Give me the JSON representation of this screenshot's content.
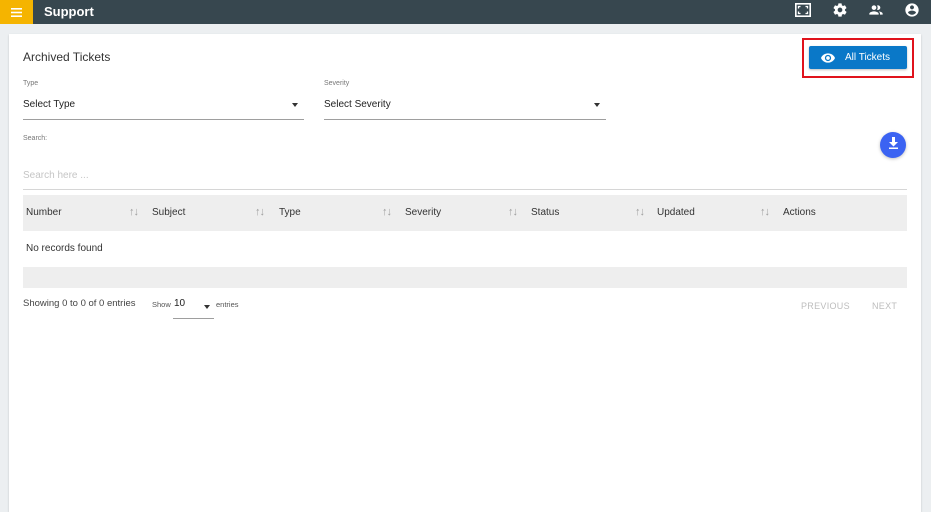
{
  "topbar": {
    "title": "Support",
    "icons": [
      "menu-icon",
      "fullscreen-icon",
      "settings-icon",
      "users-icon",
      "account-icon"
    ],
    "accent_color": "#f5b400",
    "background_color": "#37474f"
  },
  "page": {
    "title": "Archived Tickets",
    "all_tickets_label": "All Tickets",
    "all_tickets_color": "#0a78c8",
    "highlight_color": "#e0131c"
  },
  "filters": {
    "type_label": "Type",
    "type_value": "Select Type",
    "severity_label": "Severity",
    "severity_value": "Select Severity",
    "search_label": "Search:",
    "search_placeholder": "Search here ..."
  },
  "table": {
    "columns": [
      "Number",
      "Subject",
      "Type",
      "Severity",
      "Status",
      "Updated",
      "Actions"
    ],
    "sort_glyph": "↑↓",
    "empty_message": "No records found"
  },
  "footer": {
    "info": "Showing 0 to 0 of 0 entries",
    "show_label": "Show",
    "page_length": "10",
    "entries_label": "entries",
    "previous_label": "PREVIOUS",
    "next_label": "NEXT"
  }
}
